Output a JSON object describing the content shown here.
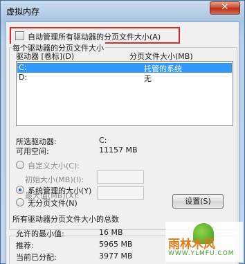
{
  "window": {
    "title": "虚拟内存",
    "close_label": "✕"
  },
  "auto_manage": {
    "label": "自动管理所有驱动器的分页文件大小(A)",
    "checked": false
  },
  "per_drive": {
    "legend": "每个驱动器的分页文件大小",
    "col_drive": "驱动器 [卷标](D)",
    "col_size": "分页文件大小(MB)",
    "drives": [
      {
        "drive": "C:",
        "size": "托管的系统",
        "selected": true
      },
      {
        "drive": "D:",
        "size": "无",
        "selected": false
      }
    ],
    "selected_drive_label": "所选驱动器:",
    "selected_drive_value": "C:",
    "free_space_label": "可用空间:",
    "free_space_value": "11157 MB",
    "custom_size_label": "自定义大小(C):",
    "initial_size_label": "初始大小(MB)(I):",
    "max_size_label": "最大值(MB)(X):",
    "system_managed_label": "系统管理的大小(Y)",
    "no_paging_label": "无分页文件(N)",
    "selected_option": "system_managed",
    "set_button": "设置(S)"
  },
  "totals": {
    "legend": "所有驱动器分页文件大小的总数",
    "min_allowed_label": "允许的最小值:",
    "min_allowed_value": "16 MB",
    "recommended_label": "推荐:",
    "recommended_value": "5965 MB",
    "current_label": "当前已分配:",
    "current_value": "3977 MB"
  },
  "watermark": {
    "text": "雨林木风",
    "url": "WWW.YLMFU.COM"
  }
}
